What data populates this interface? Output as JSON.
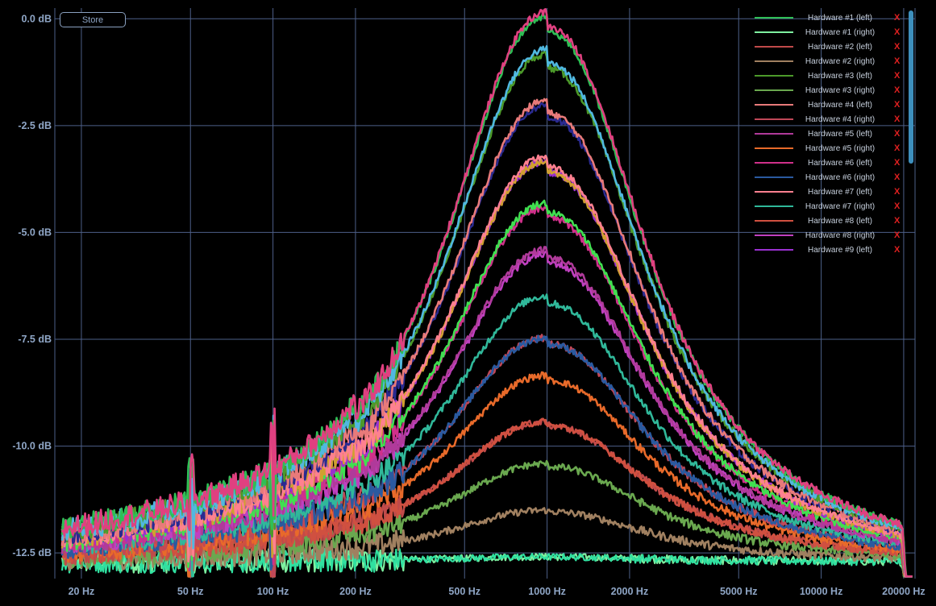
{
  "store_button": {
    "label": "Store"
  },
  "chart_data": {
    "type": "line",
    "title": "",
    "xlabel": "",
    "ylabel": "",
    "xscale": "log",
    "xlim": [
      16,
      22000
    ],
    "ylim": [
      -13.1,
      0.25
    ],
    "grid": true,
    "legend_position": "top-right",
    "x_ticks": [
      {
        "value": 20,
        "label": "20 Hz"
      },
      {
        "value": 50,
        "label": "50 Hz"
      },
      {
        "value": 100,
        "label": "100 Hz"
      },
      {
        "value": 200,
        "label": "200 Hz"
      },
      {
        "value": 500,
        "label": "500 Hz"
      },
      {
        "value": 1000,
        "label": "1000 Hz"
      },
      {
        "value": 2000,
        "label": "2000 Hz"
      },
      {
        "value": 5000,
        "label": "5000 Hz"
      },
      {
        "value": 10000,
        "label": "10000 Hz"
      },
      {
        "value": 20000,
        "label": "20000 Hz"
      }
    ],
    "y_ticks": [
      {
        "value": 0,
        "label": "0.0 dB"
      },
      {
        "value": -2.5,
        "label": "-2.5 dB"
      },
      {
        "value": -5,
        "label": "-5.0 dB"
      },
      {
        "value": -7.5,
        "label": "-7.5 dB"
      },
      {
        "value": -10,
        "label": "-10.0 dB"
      },
      {
        "value": -12.5,
        "label": "-12.5 dB"
      }
    ],
    "series": [
      {
        "name": "Hardware #1 (left)",
        "color": "#2fbf55",
        "peak_db": -1.0
      },
      {
        "name": "Hardware #1 (right)",
        "color": "#7ef0a0",
        "peak_db": -12.6
      },
      {
        "name": "Hardware #2 (left)",
        "color": "#c04a4a",
        "peak_db": -9.7
      },
      {
        "name": "Hardware #2 (right)",
        "color": "#a08060",
        "peak_db": -11.6
      },
      {
        "name": "Hardware #3 (left)",
        "color": "#4c9a2a",
        "peak_db": -1.8
      },
      {
        "name": "Hardware #3 (right)",
        "color": "#6aa84f",
        "peak_db": -10.6
      },
      {
        "name": "Hardware #4 (left)",
        "color": "#e87a7a",
        "peak_db": -2.8
      },
      {
        "name": "Hardware #4 (right)",
        "color": "#c04858",
        "peak_db": -7.9
      },
      {
        "name": "Hardware #5 (left)",
        "color": "#b03a9a",
        "peak_db": -6.0
      },
      {
        "name": "Hardware #5 (right)",
        "color": "#e86a2a",
        "peak_db": -8.7
      },
      {
        "name": "Hardware #6 (left)",
        "color": "#d0308a",
        "peak_db": -5.1
      },
      {
        "name": "Hardware #6 (right)",
        "color": "#2a5aa0",
        "peak_db": -7.9
      },
      {
        "name": "Hardware #7 (left)",
        "color": "#ff8090",
        "peak_db": -4.0
      },
      {
        "name": "Hardware #7 (right)",
        "color": "#30b89a",
        "peak_db": -7.0
      },
      {
        "name": "Hardware #8 (left)",
        "color": "#d05040",
        "peak_db": -9.7
      },
      {
        "name": "Hardware #8 (right)",
        "color": "#c040c0",
        "peak_db": -6.1
      },
      {
        "name": "Hardware #9 (left)",
        "color": "#9a30d0",
        "peak_db": -4.1
      }
    ],
    "extra_traces": [
      {
        "color": "#e04080",
        "peak_db": -0.9
      },
      {
        "color": "#50b8e0",
        "peak_db": -1.7
      },
      {
        "color": "#2a2a90",
        "peak_db": -2.9
      },
      {
        "color": "#d0a030",
        "peak_db": -4.1
      },
      {
        "color": "#40e050",
        "peak_db": -5.0
      },
      {
        "color": "#30e0a0",
        "peak_db": -12.6
      }
    ]
  },
  "legend": {
    "remove_glyph": "X"
  }
}
